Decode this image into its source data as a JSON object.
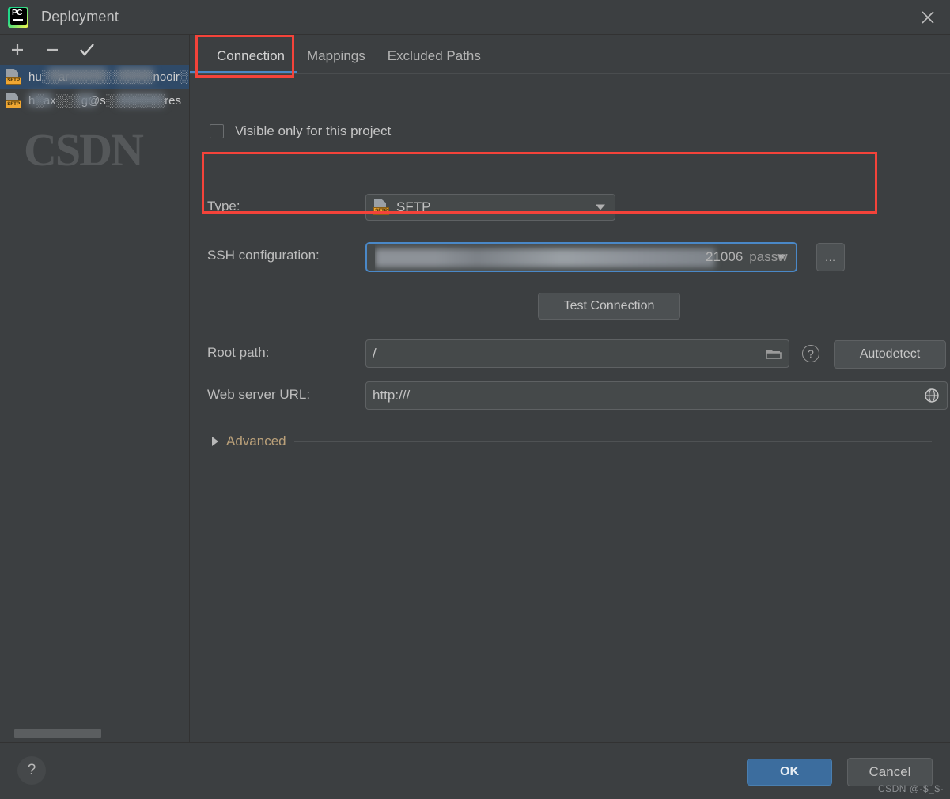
{
  "window": {
    "title": "Deployment",
    "logo_icon": "pycharm-logo",
    "close_icon": "close-icon"
  },
  "sidebar": {
    "toolbar": [
      {
        "name": "add",
        "icon": "plus-icon",
        "glyph": "+"
      },
      {
        "name": "remove",
        "icon": "minus-icon",
        "glyph": "−"
      },
      {
        "name": "set-default",
        "icon": "check-icon",
        "glyph": "✓"
      }
    ],
    "items": [
      {
        "icon": "sftp-icon",
        "badge": "SFTP",
        "label": "hu░░ar░░░░░░░░░░nooir░",
        "selected": true
      },
      {
        "icon": "sftp-icon",
        "badge": "SFTP",
        "label": "h░ax░░░g@s░░░░░░░res",
        "selected": false
      }
    ],
    "scrollbar": "horizontal-scrollbar"
  },
  "tabs": [
    {
      "label": "Connection",
      "active": true
    },
    {
      "label": "Mappings",
      "active": false
    },
    {
      "label": "Excluded Paths",
      "active": false
    }
  ],
  "form": {
    "visible_only": {
      "label": "Visible only for this project",
      "checked": false
    },
    "type": {
      "label": "Type:",
      "value": "SFTP",
      "icon": "sftp-icon",
      "badge": "SFTP"
    },
    "ssh_configuration": {
      "label": "SSH configuration:",
      "value_visible_tail": "21006",
      "auth_method": "password",
      "browse_button": "...",
      "redacted": true
    },
    "test_connection": {
      "label": "Test Connection"
    },
    "root_path": {
      "label": "Root path:",
      "value": "/",
      "folder_icon": "folder-icon",
      "help_icon": "help-circle-icon",
      "autodetect_label": "Autodetect"
    },
    "web_server_url": {
      "label": "Web server URL:",
      "value": "http:///",
      "globe_icon": "globe-icon"
    },
    "advanced": {
      "label": "Advanced",
      "expanded": false,
      "arrow_icon": "chevron-right-icon"
    }
  },
  "footer": {
    "help_label": "?",
    "ok_label": "OK",
    "cancel_label": "Cancel",
    "watermark": "CSDN @-$_$-"
  },
  "colors": {
    "background": "#3c3f41",
    "field_background": "#45494a",
    "accent_blue": "#4a88c7",
    "selection_blue": "#2f4a68",
    "ok_button": "#3c6d9e",
    "annotation_red": "#f4433a",
    "advanced_text": "#bba17a",
    "sftp_badge": "#f0a732"
  },
  "annotations": [
    {
      "name": "connection-tab-highlight"
    },
    {
      "name": "ssh-configuration-highlight"
    }
  ]
}
